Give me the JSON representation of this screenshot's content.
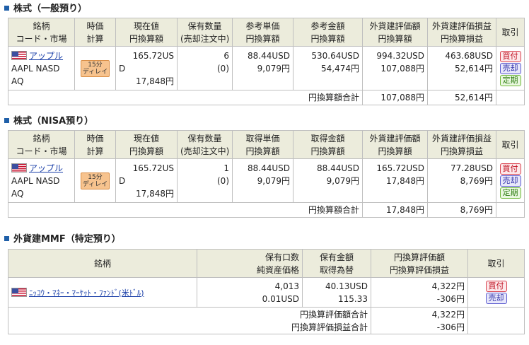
{
  "section1": {
    "title": "株式（一般預り）",
    "headers": [
      [
        "銘柄",
        "コード・市場"
      ],
      [
        "時価",
        "計算"
      ],
      [
        "現在値",
        "円換算額"
      ],
      [
        "保有数量",
        "(売却注文中)"
      ],
      [
        "参考単価",
        "円換算額"
      ],
      [
        "参考金額",
        "円換算額"
      ],
      [
        "外貨建評価額",
        "円換算額"
      ],
      [
        "外貨建評価損益",
        "円換算損益"
      ],
      [
        "取引"
      ]
    ],
    "row": {
      "name": "アップル",
      "code1": "AAPL NASD",
      "code2": "AQ",
      "delay1": "15分",
      "delay2": "ディレイ",
      "price1": "165.72US",
      "price2": "D",
      "price3": "17,848円",
      "qty": "6",
      "qty_pending": "(0)",
      "unit": "88.44USD",
      "unit_jpy": "9,079円",
      "amount": "530.64USD",
      "amount_jpy": "54,474円",
      "eval": "994.32USD",
      "eval_jpy": "107,088円",
      "pl": "463.68USD",
      "pl_jpy": "52,614円",
      "buy": "買付",
      "sell": "売却",
      "limit": "定期"
    },
    "sum_label": "円換算額合計",
    "sum_eval": "107,088円",
    "sum_pl": "52,614円"
  },
  "section2": {
    "title": "株式（NISA預り）",
    "headers": [
      [
        "銘柄",
        "コード・市場"
      ],
      [
        "時価",
        "計算"
      ],
      [
        "現在値",
        "円換算額"
      ],
      [
        "保有数量",
        "(売却注文中)"
      ],
      [
        "取得単価",
        "円換算額"
      ],
      [
        "取得金額",
        "円換算額"
      ],
      [
        "外貨建評価額",
        "円換算額"
      ],
      [
        "外貨建評価損益",
        "円換算損益"
      ],
      [
        "取引"
      ]
    ],
    "row": {
      "name": "アップル",
      "code1": "AAPL NASD",
      "code2": "AQ",
      "delay1": "15分",
      "delay2": "ディレイ",
      "price1": "165.72US",
      "price2": "D",
      "price3": "17,848円",
      "qty": "1",
      "qty_pending": "(0)",
      "unit": "88.44USD",
      "unit_jpy": "9,079円",
      "amount": "88.44USD",
      "amount_jpy": "9,079円",
      "eval": "165.72USD",
      "eval_jpy": "17,848円",
      "pl": "77.28USD",
      "pl_jpy": "8,769円",
      "buy": "買付",
      "sell": "売却",
      "limit": "定期"
    },
    "sum_label": "円換算額合計",
    "sum_eval": "17,848円",
    "sum_pl": "8,769円"
  },
  "section3": {
    "title": "外貨建MMF（特定預り）",
    "headers": [
      [
        "銘柄"
      ],
      [
        "保有口数",
        "純資産価格"
      ],
      [
        "保有金額",
        "取得為替"
      ],
      [
        "円換算評価額",
        "円換算評価損益"
      ],
      [
        "取引"
      ]
    ],
    "row": {
      "name": "ﾆｯｺｳ・ﾏﾈｰ・ﾏｰｹｯﾄ・ﾌｧﾝﾄﾞ(米ﾄﾞﾙ)",
      "units": "4,013",
      "nav": "0.01USD",
      "amount": "40.13USD",
      "fx": "115.33",
      "eval": "4,322円",
      "pl": "-306円",
      "buy": "買付",
      "sell": "売却"
    },
    "sum_eval_label": "円換算評価額合計",
    "sum_eval": "4,322円",
    "sum_pl_label": "円換算評価損益合計",
    "sum_pl": "-306円"
  }
}
